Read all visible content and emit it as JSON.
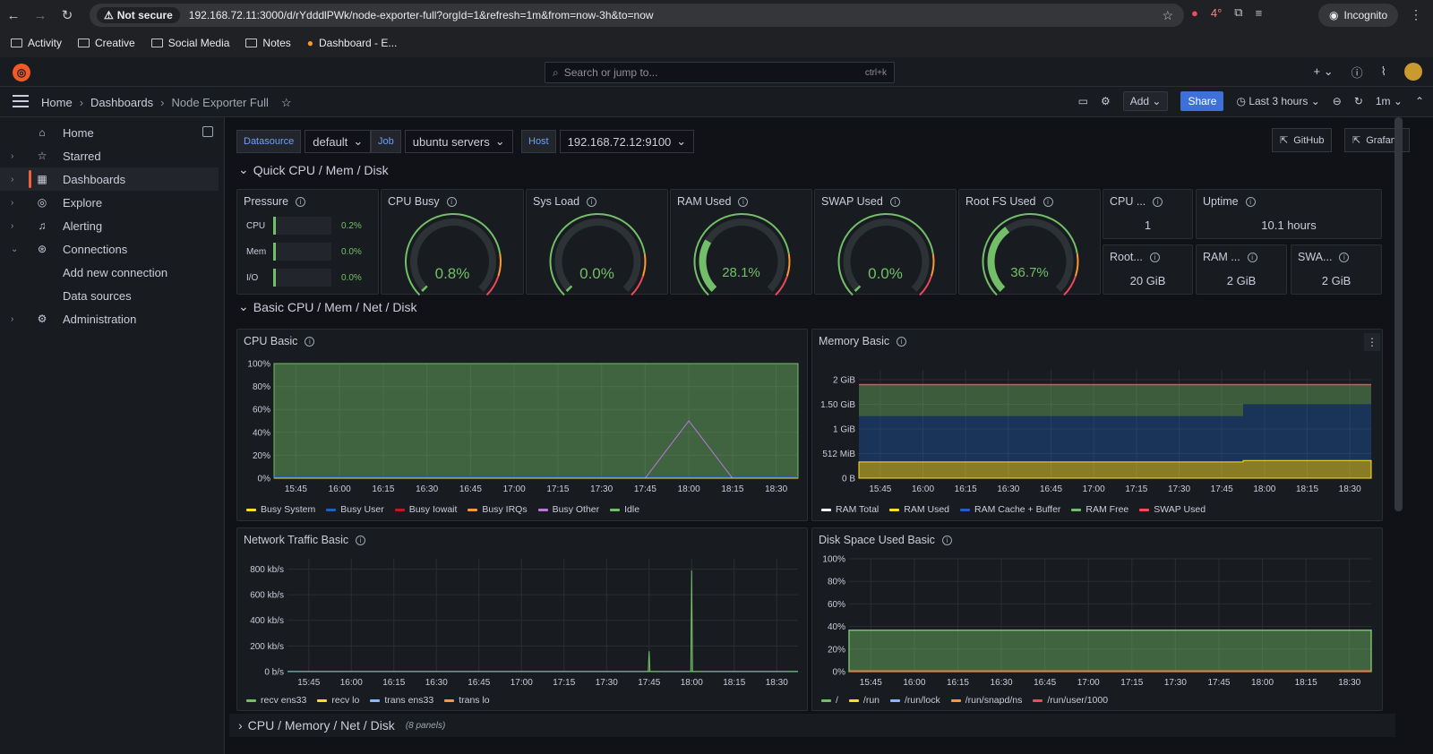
{
  "browser": {
    "security": "Not secure",
    "url": "192.168.72.11:3000/d/rYdddlPWk/node-exporter-full?orgId=1&refresh=1m&from=now-3h&to=now",
    "incognito": "Incognito",
    "ext_badge": "4°",
    "bookmarks": [
      "Activity",
      "Creative",
      "Social Media",
      "Notes",
      "Dashboard - E..."
    ]
  },
  "topnav": {
    "search_placeholder": "Search or jump to...",
    "shortcut": "ctrl+k",
    "plus": "+"
  },
  "breadcrumb": {
    "home": "Home",
    "dashboards": "Dashboards",
    "current": "Node Exporter Full"
  },
  "toolbar": {
    "add": "Add",
    "share": "Share",
    "time_range": "Last 3 hours",
    "refresh": "1m"
  },
  "sidebar": {
    "items": [
      {
        "label": "Home",
        "icon": "home-icon"
      },
      {
        "label": "Starred",
        "icon": "star-icon"
      },
      {
        "label": "Dashboards",
        "icon": "dashboards-icon"
      },
      {
        "label": "Explore",
        "icon": "explore-icon"
      },
      {
        "label": "Alerting",
        "icon": "bell-icon"
      },
      {
        "label": "Connections",
        "icon": "connections-icon"
      },
      {
        "label": "Add new connection"
      },
      {
        "label": "Data sources"
      },
      {
        "label": "Administration",
        "icon": "gear-icon"
      }
    ]
  },
  "variables": {
    "datasource_label": "Datasource",
    "datasource_value": "default",
    "job_label": "Job",
    "job_value": "ubuntu servers",
    "host_label": "Host",
    "host_value": "192.168.72.12:9100"
  },
  "links": {
    "github": "GitHub",
    "grafana": "Grafana"
  },
  "rows": {
    "quick": "Quick CPU / Mem / Disk",
    "basic": "Basic CPU / Mem / Net / Disk",
    "full": "CPU / Memory / Net / Disk",
    "full_count": "(8 panels)"
  },
  "pressure": {
    "title": "Pressure",
    "rows": [
      {
        "label": "CPU",
        "value": "0.2%",
        "fraction": 0.002
      },
      {
        "label": "Mem",
        "value": "0.0%",
        "fraction": 0.0
      },
      {
        "label": "I/O",
        "value": "0.0%",
        "fraction": 0.0
      }
    ]
  },
  "gauges": [
    {
      "title": "CPU Busy",
      "value": "0.8%",
      "percent": 0.8
    },
    {
      "title": "Sys Load",
      "value": "0.0%",
      "percent": 0.0
    },
    {
      "title": "RAM Used",
      "value": "28.1%",
      "percent": 28.1
    },
    {
      "title": "SWAP Used",
      "value": "0.0%",
      "percent": 0.0
    },
    {
      "title": "Root FS Used",
      "value": "36.7%",
      "percent": 36.7
    }
  ],
  "stats": {
    "cpu_cores": {
      "title": "CPU ...",
      "value": "1"
    },
    "uptime": {
      "title": "Uptime",
      "value": "10.1 hours"
    },
    "rootfs": {
      "title": "Root...",
      "value": "20 GiB"
    },
    "ram": {
      "title": "RAM ...",
      "value": "2 GiB"
    },
    "swap": {
      "title": "SWA...",
      "value": "2 GiB"
    }
  },
  "colors": {
    "green": "#73bf69",
    "yellow": "#fade2a",
    "blue": "#5794f2",
    "red": "#f2495c",
    "orange": "#ff9830",
    "purple": "#b877d9",
    "darkblue": "#1f60c4",
    "accent": "#f55f3e"
  },
  "chart_data": [
    {
      "type": "area",
      "title": "CPU Basic",
      "x": [
        "15:45",
        "16:00",
        "16:15",
        "16:30",
        "16:45",
        "17:00",
        "17:15",
        "17:30",
        "17:45",
        "18:00",
        "18:15",
        "18:30"
      ],
      "ylabels": [
        "0%",
        "20%",
        "40%",
        "60%",
        "80%",
        "100%"
      ],
      "ylim": [
        0,
        100
      ],
      "series": [
        {
          "name": "Busy System",
          "color": "#fade2a",
          "values": [
            0,
            0,
            0,
            0,
            0,
            0,
            0,
            0,
            0,
            0,
            0,
            0
          ]
        },
        {
          "name": "Busy User",
          "color": "#1f60c4",
          "values": [
            1,
            1,
            1,
            1,
            1,
            1,
            1,
            1,
            1,
            1,
            1,
            1
          ]
        },
        {
          "name": "Busy Iowait",
          "color": "#c4162a",
          "values": [
            0,
            0,
            0,
            0,
            0,
            0,
            0,
            0,
            0,
            0,
            0,
            0
          ]
        },
        {
          "name": "Busy IRQs",
          "color": "#ff9830",
          "values": [
            0,
            0,
            0,
            0,
            0,
            0,
            0,
            0,
            0,
            0,
            0,
            0
          ]
        },
        {
          "name": "Busy Other",
          "color": "#b877d9",
          "values": [
            0,
            0,
            0,
            0,
            0,
            0,
            0,
            0,
            0,
            50,
            0,
            0
          ]
        },
        {
          "name": "Idle",
          "color": "#73bf69",
          "values": [
            99,
            99,
            99,
            99,
            99,
            99,
            99,
            99,
            99,
            99,
            99,
            99
          ]
        }
      ]
    },
    {
      "type": "area",
      "title": "Memory Basic",
      "x": [
        "15:45",
        "16:00",
        "16:15",
        "16:30",
        "16:45",
        "17:00",
        "17:15",
        "17:30",
        "17:45",
        "18:00",
        "18:15",
        "18:30"
      ],
      "ylabels": [
        "0 B",
        "512 MiB",
        "1 GiB",
        "1.50 GiB",
        "2 GiB"
      ],
      "ylim": [
        0,
        2.2
      ],
      "series": [
        {
          "name": "RAM Total",
          "color": "#ffffff",
          "values": [
            1.9,
            1.9,
            1.9,
            1.9,
            1.9,
            1.9,
            1.9,
            1.9,
            1.9,
            1.9,
            1.9,
            1.9
          ]
        },
        {
          "name": "RAM Used",
          "color": "#fade2a",
          "values": [
            0.33,
            0.33,
            0.33,
            0.33,
            0.33,
            0.33,
            0.33,
            0.33,
            0.33,
            0.36,
            0.36,
            0.36
          ]
        },
        {
          "name": "RAM Cache + Buffer",
          "color": "#1f60c4",
          "values": [
            0.93,
            0.93,
            0.93,
            0.93,
            0.93,
            0.93,
            0.93,
            0.93,
            0.93,
            1.15,
            1.15,
            1.15
          ]
        },
        {
          "name": "RAM Free",
          "color": "#73bf69",
          "values": [
            0.64,
            0.64,
            0.64,
            0.64,
            0.64,
            0.64,
            0.64,
            0.64,
            0.64,
            0.39,
            0.39,
            0.39
          ]
        },
        {
          "name": "SWAP Used",
          "color": "#f2495c",
          "values": [
            0,
            0,
            0,
            0,
            0,
            0,
            0,
            0,
            0,
            0,
            0,
            0
          ]
        }
      ]
    },
    {
      "type": "line",
      "title": "Network Traffic Basic",
      "x": [
        "15:45",
        "16:00",
        "16:15",
        "16:30",
        "16:45",
        "17:00",
        "17:15",
        "17:30",
        "17:45",
        "18:00",
        "18:15",
        "18:30"
      ],
      "ylabels": [
        "0 b/s",
        "200 kb/s",
        "400 kb/s",
        "600 kb/s",
        "800 kb/s"
      ],
      "ylim": [
        0,
        880
      ],
      "series": [
        {
          "name": "recv ens33",
          "color": "#73bf69",
          "values": [
            2,
            2,
            2,
            2,
            2,
            2,
            2,
            2,
            160,
            790,
            2,
            2
          ]
        },
        {
          "name": "recv lo",
          "color": "#fade2a",
          "values": [
            0,
            0,
            0,
            0,
            0,
            0,
            0,
            0,
            0,
            0,
            0,
            0
          ]
        },
        {
          "name": "trans ens33",
          "color": "#8ab8ff",
          "values": [
            1,
            1,
            1,
            1,
            1,
            1,
            1,
            1,
            1,
            1,
            1,
            1
          ]
        },
        {
          "name": "trans lo",
          "color": "#ff9830",
          "values": [
            0,
            0,
            0,
            0,
            0,
            0,
            0,
            0,
            0,
            0,
            0,
            0
          ]
        }
      ]
    },
    {
      "type": "area",
      "title": "Disk Space Used Basic",
      "x": [
        "15:45",
        "16:00",
        "16:15",
        "16:30",
        "16:45",
        "17:00",
        "17:15",
        "17:30",
        "17:45",
        "18:00",
        "18:15",
        "18:30"
      ],
      "ylabels": [
        "0%",
        "20%",
        "40%",
        "60%",
        "80%",
        "100%"
      ],
      "ylim": [
        0,
        100
      ],
      "series": [
        {
          "name": "/",
          "color": "#73bf69",
          "values": [
            36.7,
            36.7,
            36.7,
            36.7,
            36.7,
            36.7,
            36.7,
            36.7,
            36.7,
            36.7,
            36.7,
            36.7
          ]
        },
        {
          "name": "/run",
          "color": "#fade2a",
          "values": [
            0.5,
            0.5,
            0.5,
            0.5,
            0.5,
            0.5,
            0.5,
            0.5,
            0.5,
            0.5,
            0.5,
            0.5
          ]
        },
        {
          "name": "/run/lock",
          "color": "#8ab8ff",
          "values": [
            0,
            0,
            0,
            0,
            0,
            0,
            0,
            0,
            0,
            0,
            0,
            0
          ]
        },
        {
          "name": "/run/snapd/ns",
          "color": "#ff9830",
          "values": [
            0.5,
            0.5,
            0.5,
            0.5,
            0.5,
            0.5,
            0.5,
            0.5,
            0.5,
            0.5,
            0.5,
            0.5
          ]
        },
        {
          "name": "/run/user/1000",
          "color": "#f2495c",
          "values": [
            0,
            0,
            0,
            0,
            0,
            0,
            0,
            0,
            0,
            0,
            0,
            0
          ]
        }
      ]
    }
  ]
}
